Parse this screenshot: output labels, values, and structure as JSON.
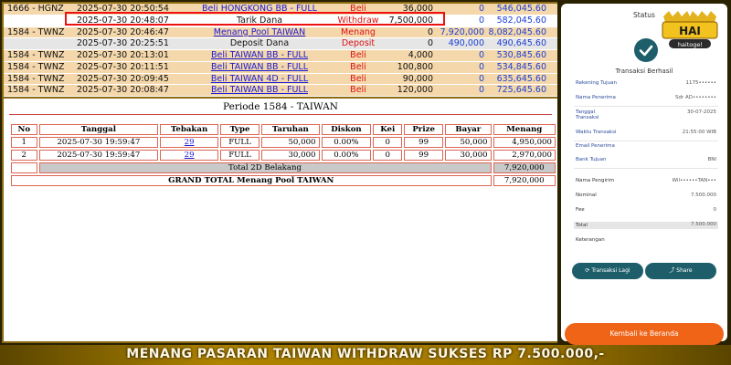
{
  "transactions": [
    {
      "id": "1666 - HGNZ",
      "date": "2025-07-30 20:50:54",
      "desc": "Beli HONGKONG BB - FULL",
      "type": "Beli",
      "amount": "36,000",
      "credit": "0",
      "balance": "546,045.60",
      "style": "peach",
      "link": true
    },
    {
      "id": "",
      "date": "2025-07-30 20:48:07",
      "desc": "Tarik Dana",
      "type": "Withdraw",
      "amount": "7,500,000",
      "credit": "0",
      "balance": "582,045.60",
      "style": "white",
      "link": false
    },
    {
      "id": "1584 - TWNZ",
      "date": "2025-07-30 20:46:47",
      "desc": "Menang Pool TAIWAN",
      "type": "Menang",
      "amount": "0",
      "credit": "7,920,000",
      "balance": "8,082,045.60",
      "style": "peach",
      "link": true
    },
    {
      "id": "",
      "date": "2025-07-30 20:25:51",
      "desc": "Deposit Dana",
      "type": "Deposit",
      "amount": "0",
      "credit": "490,000",
      "balance": "490,645.60",
      "style": "gray",
      "link": false
    },
    {
      "id": "1584 - TWNZ",
      "date": "2025-07-30 20:13:01",
      "desc": "Beli TAIWAN BB - FULL",
      "type": "Beli",
      "amount": "4,000",
      "credit": "0",
      "balance": "530,845.60",
      "style": "peach",
      "link": true
    },
    {
      "id": "1584 - TWNZ",
      "date": "2025-07-30 20:11:51",
      "desc": "Beli TAIWAN BB - FULL",
      "type": "Beli",
      "amount": "100,800",
      "credit": "0",
      "balance": "534,845.60",
      "style": "peach",
      "link": true
    },
    {
      "id": "1584 - TWNZ",
      "date": "2025-07-30 20:09:45",
      "desc": "Beli TAIWAN 4D - FULL",
      "type": "Beli",
      "amount": "90,000",
      "credit": "0",
      "balance": "635,645.60",
      "style": "peach",
      "link": true
    },
    {
      "id": "1584 - TWNZ",
      "date": "2025-07-30 20:08:47",
      "desc": "Beli TAIWAN BB - FULL",
      "type": "Beli",
      "amount": "120,000",
      "credit": "0",
      "balance": "725,645.60",
      "style": "peach",
      "link": true
    }
  ],
  "periode": {
    "title": "Periode 1584 - TAIWAN",
    "headers": [
      "No",
      "Tanggal",
      "Tebakan",
      "Type",
      "Taruhan",
      "Diskon",
      "Kei",
      "Prize",
      "Bayar",
      "Menang"
    ],
    "rows": [
      [
        "1",
        "2025-07-30 19:59:47",
        "29",
        "FULL",
        "50,000",
        "0.00%",
        "0",
        "99",
        "50,000",
        "4,950,000"
      ],
      [
        "2",
        "2025-07-30 19:59:47",
        "29",
        "FULL",
        "30,000",
        "0.00%",
        "0",
        "99",
        "30,000",
        "2,970,000"
      ]
    ],
    "subtotal_label": "Total 2D Belakang",
    "subtotal_value": "7,920,000",
    "grand_label": "GRAND TOTAL  Menang Pool TAIWAN",
    "grand_value": "7,920,000"
  },
  "receipt": {
    "status_label": "Status",
    "logo_text": "HAITOGEL",
    "logo_sub": "haitogel",
    "success_label": "Transaksi Berhasil",
    "fields": [
      {
        "label": "Rekening Tujuan",
        "value": "1175••••••"
      },
      {
        "label": "Nama Penerima",
        "value": "Sdr AD••••••••"
      },
      {
        "label": "Tanggal Transaksi",
        "value": "30-07-2025"
      },
      {
        "label": "Waktu Transaksi",
        "value": "21:55:00 WIB"
      },
      {
        "label": "Email Penerima",
        "value": ""
      },
      {
        "label": "Bank Tujuan",
        "value": "BNI"
      },
      {
        "label": "Nama Pengirim",
        "value": "Wil••••••TAN•••"
      },
      {
        "label": "Nominal",
        "value": "7.500.000"
      },
      {
        "label": "Fee",
        "value": "0"
      },
      {
        "label": "Total",
        "value": "7.500.000"
      },
      {
        "label": "Keterangan",
        "value": ""
      }
    ],
    "repeat_button": "Transaksi Lagi",
    "share_button": "Share",
    "home_button": "Kembali ke Beranda"
  },
  "banner": "MENANG PASARAN TAIWAN WITHDRAW SUKSES RP 7.500.000,-",
  "colors": {
    "accent": "#1e5e6a",
    "home_button": "#f06418",
    "highlight": "#e11111"
  }
}
